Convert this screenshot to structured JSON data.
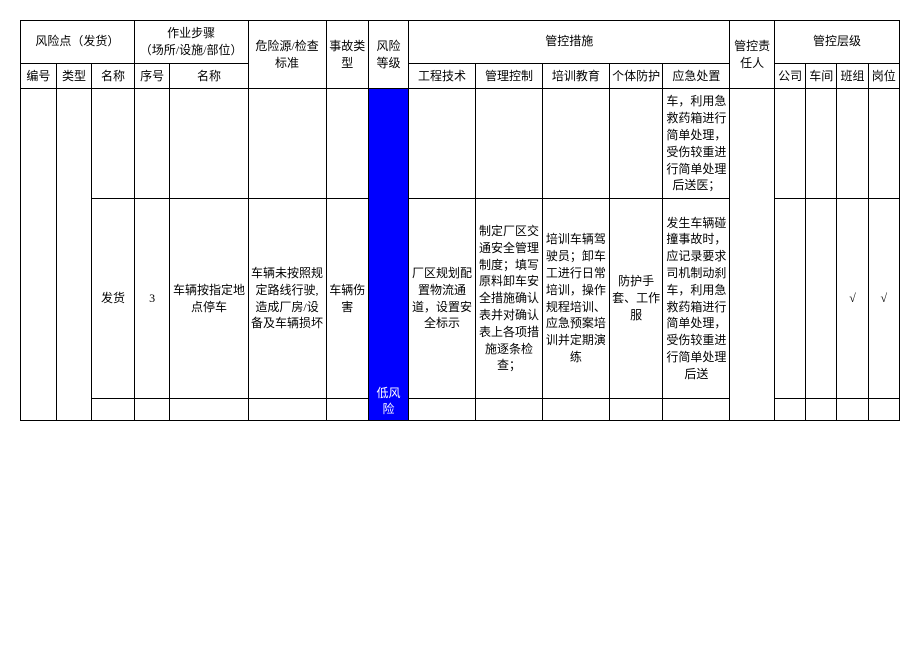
{
  "header": {
    "risk_point": "风险点（发货）",
    "work_steps": "作业步骤\n（场所/设施/部位）",
    "hazard_check": "危险源/检查标准",
    "accident_type": "事故类型",
    "risk_level": "风险等级",
    "control_measures": "管控措施",
    "responsible": "管控责任人",
    "control_level": "管控层级",
    "sub": {
      "num": "编号",
      "type": "类型",
      "name": "名称",
      "seq": "序号",
      "step_name": "名称",
      "engineering": "工程技术",
      "management": "管理控制",
      "training": "培训教育",
      "ppe": "个体防护",
      "emergency": "应急处置",
      "company": "公司",
      "workshop": "车间",
      "team": "班组",
      "post": "岗位"
    }
  },
  "low_risk_label": "低风险",
  "rows": [
    {
      "emergency": "车，利用急救药箱进行简单处理，受伤较重进行简单处理后送医；"
    },
    {
      "name": "发货",
      "seq": "3",
      "step_name": "车辆按指定地点停车",
      "hazard": "车辆未按照规定路线行驶,造成厂房/设备及车辆损坏",
      "accident": "车辆伤害",
      "engineering": "厂区规划配置物流通道，设置安全标示",
      "management": "制定厂区交通安全管理制度；填写原料卸车安全措施确认表并对确认表上各项措施逐条检查；",
      "training": "培训车辆驾驶员；卸车工进行日常培训，操作规程培训、应急预案培训并定期演练",
      "ppe": "防护手套、工作服",
      "emergency": "发生车辆碰撞事故时，应记录要求司机制动刹车，利用急救药箱进行简单处理，受伤较重进行简单处理后送",
      "team_check": "√",
      "post_check": "√"
    }
  ]
}
